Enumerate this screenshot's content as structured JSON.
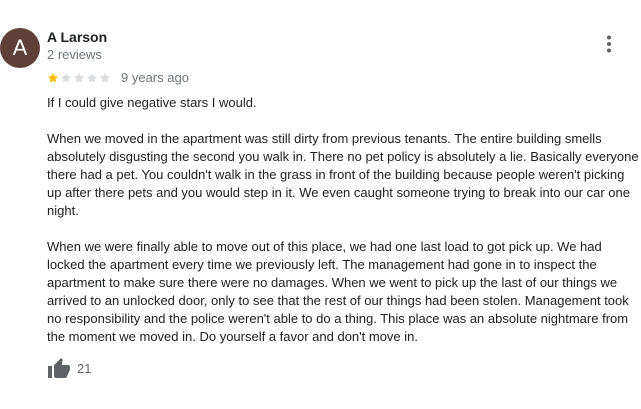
{
  "reviewer": {
    "initial": "A",
    "name": "A Larson",
    "review_count": "2 reviews",
    "avatar_color": "#5d4037"
  },
  "rating": {
    "value": 1,
    "max": 5,
    "filled_color": "#fbbc04",
    "empty_color": "#dadce0"
  },
  "date": "9 years ago",
  "review_paragraphs": [
    "If I could give negative stars I would.",
    "When we moved in the apartment was still dirty from previous tenants. The entire building smells absolutely disgusting the second you walk in. There no pet policy is absolutely a lie. Basically everyone there had a pet. You couldn't walk in the grass in front of the building because people weren't picking up after there pets and you would step in it. We even caught someone trying to break into our car one night.",
    "When we were finally able to move out of this place, we had one last load to got pick up. We had locked the apartment every time we previously left. The management had gone in to inspect the apartment to make sure there were no damages. When we went to pick up the last of our things we arrived to an unlocked door, only to see that the rest of our things had been stolen. Management took no responsibility and the police weren't able to do a thing. This place was an absolute nightmare from the moment we moved in. Do yourself a favor and don't move in."
  ],
  "likes": {
    "count": "21",
    "icon": "thumbs-up-icon"
  },
  "menu_icon": "more-vert-icon"
}
